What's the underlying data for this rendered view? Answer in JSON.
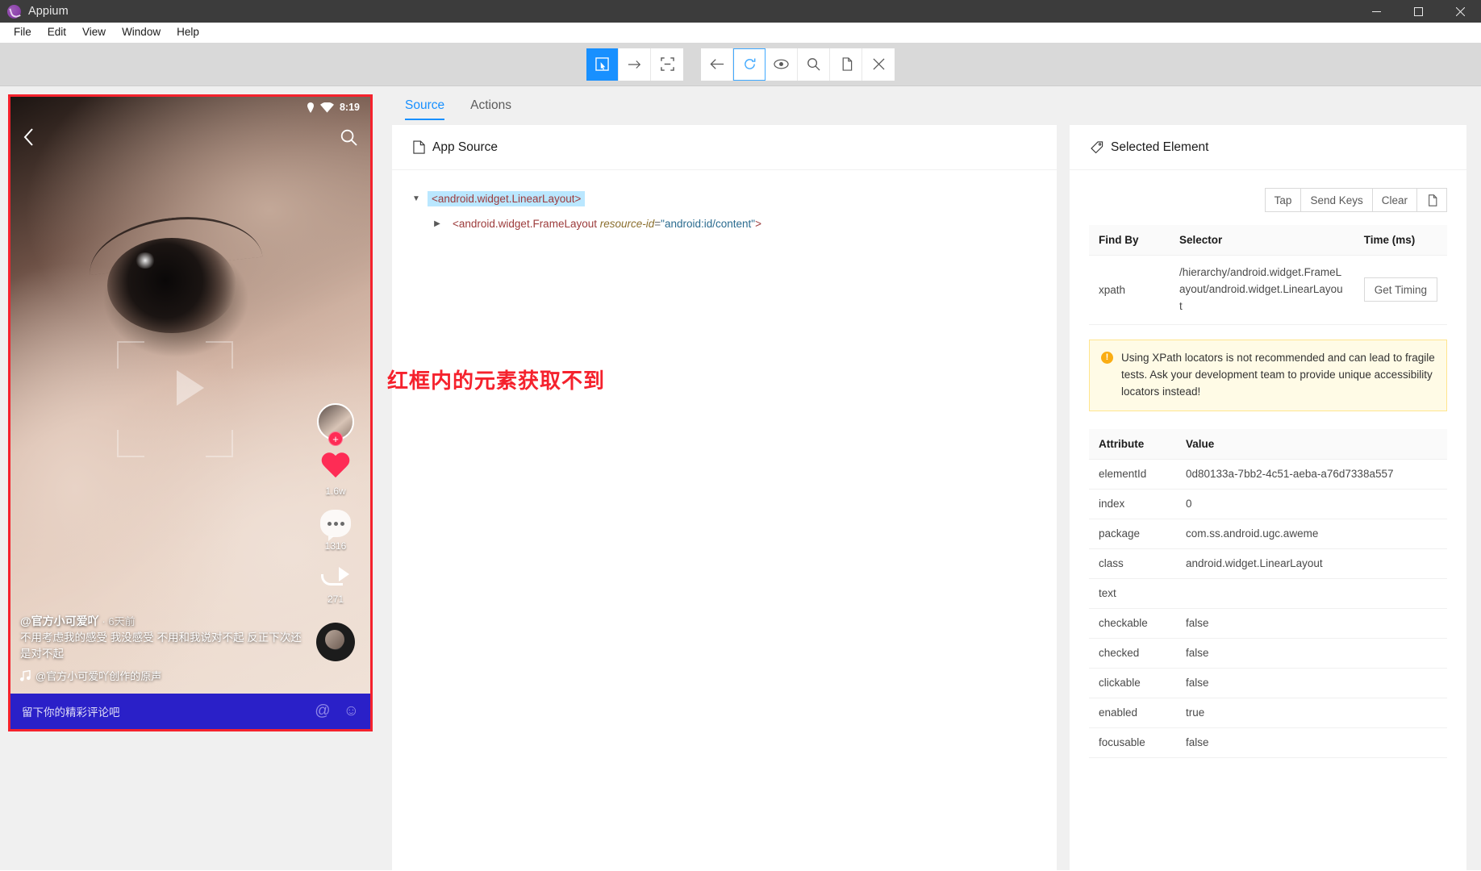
{
  "titlebar": {
    "app_name": "Appium"
  },
  "menubar": {
    "items": [
      {
        "label": "File"
      },
      {
        "label": "Edit"
      },
      {
        "label": "View"
      },
      {
        "label": "Window"
      },
      {
        "label": "Help"
      }
    ]
  },
  "toolbar": {
    "group1": [
      {
        "name": "select-element-icon",
        "active": true
      },
      {
        "name": "swipe-icon",
        "active": false
      },
      {
        "name": "tap-by-coordinates-icon",
        "active": false
      }
    ],
    "group2": [
      {
        "name": "back-icon"
      },
      {
        "name": "refresh-icon"
      },
      {
        "name": "eye-icon"
      },
      {
        "name": "search-icon"
      },
      {
        "name": "copy-icon"
      },
      {
        "name": "close-icon"
      }
    ]
  },
  "device": {
    "status_time": "8:19",
    "overlay_note": "红框内的元素获取不到",
    "rail": {
      "like_count": "1.6w",
      "comment_count": "1316",
      "share_count": "271",
      "follow_plus": "+"
    },
    "caption": {
      "user": "@官方小可爱吖",
      "ago": "· 6天前",
      "text": "不用考虑我的感受 我没感受 不用和我说对不起 反正下次还是对不起",
      "music": "@官方小可爱吖创作的原声"
    },
    "comment_bar": {
      "placeholder": "留下你的精彩评论吧",
      "at_icon": "@",
      "emoji_icon": "☺"
    }
  },
  "tabs": [
    {
      "label": "Source",
      "active": true
    },
    {
      "label": "Actions",
      "active": false
    }
  ],
  "app_source": {
    "title": "App Source",
    "tree": [
      {
        "open": true,
        "selected": true,
        "tag": "<android.widget.LinearLayout>"
      },
      {
        "open": false,
        "selected": false,
        "tag_open": "<android.widget.FrameLayout",
        "attr_key": "resource-id",
        "attr_eq": "=",
        "attr_val": "\"android:id/content\"",
        "tag_close": ">"
      }
    ]
  },
  "selected_element": {
    "title": "Selected Element",
    "actions": [
      {
        "label": "Tap"
      },
      {
        "label": "Send Keys"
      },
      {
        "label": "Clear"
      },
      {
        "label": "copy-icon"
      }
    ],
    "selector_table": {
      "headers": [
        "Find By",
        "Selector",
        "Time (ms)"
      ],
      "rows": [
        {
          "find_by": "xpath",
          "selector": "/hierarchy/android.widget.FrameLayout/android.widget.LinearLayout",
          "timing_button": "Get Timing"
        }
      ]
    },
    "warning": "Using XPath locators is not recommended and can lead to fragile tests. Ask your development team to provide unique accessibility locators instead!",
    "warning_icon": "!",
    "attribute_table": {
      "headers": [
        "Attribute",
        "Value"
      ],
      "rows": [
        {
          "attribute": "elementId",
          "value": "0d80133a-7bb2-4c51-aeba-a76d7338a557"
        },
        {
          "attribute": "index",
          "value": "0"
        },
        {
          "attribute": "package",
          "value": "com.ss.android.ugc.aweme"
        },
        {
          "attribute": "class",
          "value": "android.widget.LinearLayout"
        },
        {
          "attribute": "text",
          "value": ""
        },
        {
          "attribute": "checkable",
          "value": "false"
        },
        {
          "attribute": "checked",
          "value": "false"
        },
        {
          "attribute": "clickable",
          "value": "false"
        },
        {
          "attribute": "enabled",
          "value": "true"
        },
        {
          "attribute": "focusable",
          "value": "false"
        }
      ]
    }
  },
  "colors": {
    "accent_blue": "#1890ff",
    "red_frame": "#f5222d",
    "warn_bg": "#fffbe6",
    "warn_border": "#ffe58f",
    "titlebar": "#3c3c3c"
  }
}
